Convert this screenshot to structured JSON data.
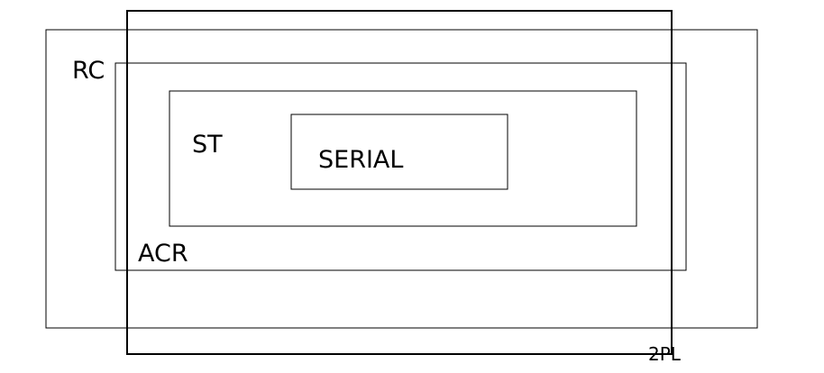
{
  "diagram": {
    "stroke_color": "#000000",
    "background": "#ffffff",
    "labels": {
      "rc": "RC",
      "acr": "ACR",
      "st": "ST",
      "serial": "SERIAL",
      "two_pl": "2PL"
    }
  }
}
